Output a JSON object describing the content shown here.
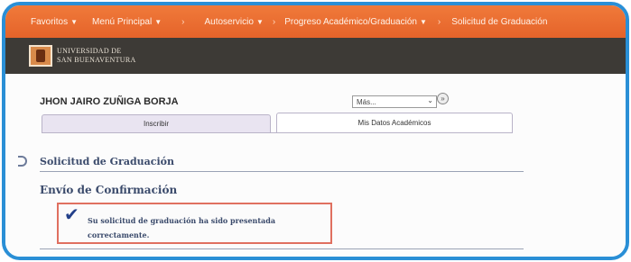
{
  "nav": {
    "items": [
      {
        "label": "Favoritos",
        "has_menu": true
      },
      {
        "label": "Menú Principal",
        "has_menu": true
      },
      {
        "label": "Autoservicio",
        "has_menu": true
      },
      {
        "label": "Progreso Académico/Graduación",
        "has_menu": true
      },
      {
        "label": "Solicitud de Graduación",
        "has_menu": false
      }
    ],
    "separator": "›"
  },
  "brand": {
    "line1": "UNIVERSIDAD DE",
    "line2": "SAN BUENAVENTURA",
    "line3": ""
  },
  "student": {
    "name": "JHON JAIRO ZUÑIGA BORJA"
  },
  "select": {
    "value": "Más..."
  },
  "tabs": [
    {
      "label": "Inscribir",
      "active": false
    },
    {
      "label": "Mis Datos Académicos",
      "active": true
    }
  ],
  "page": {
    "section_title": "Solicitud de Graduación",
    "confirm_title": "Envío de Confirmación",
    "message": "Su solicitud de graduación ha sido presentada correctamente."
  },
  "colors": {
    "frame": "#2a8fd6",
    "nav_bg": "#e5632a",
    "brand_bg": "#3d3a36",
    "message_border": "#e07060",
    "check": "#23408a"
  },
  "icons": {
    "check": "check-icon",
    "go": "go-arrow-icon",
    "dropdown": "chevron-down-icon"
  }
}
